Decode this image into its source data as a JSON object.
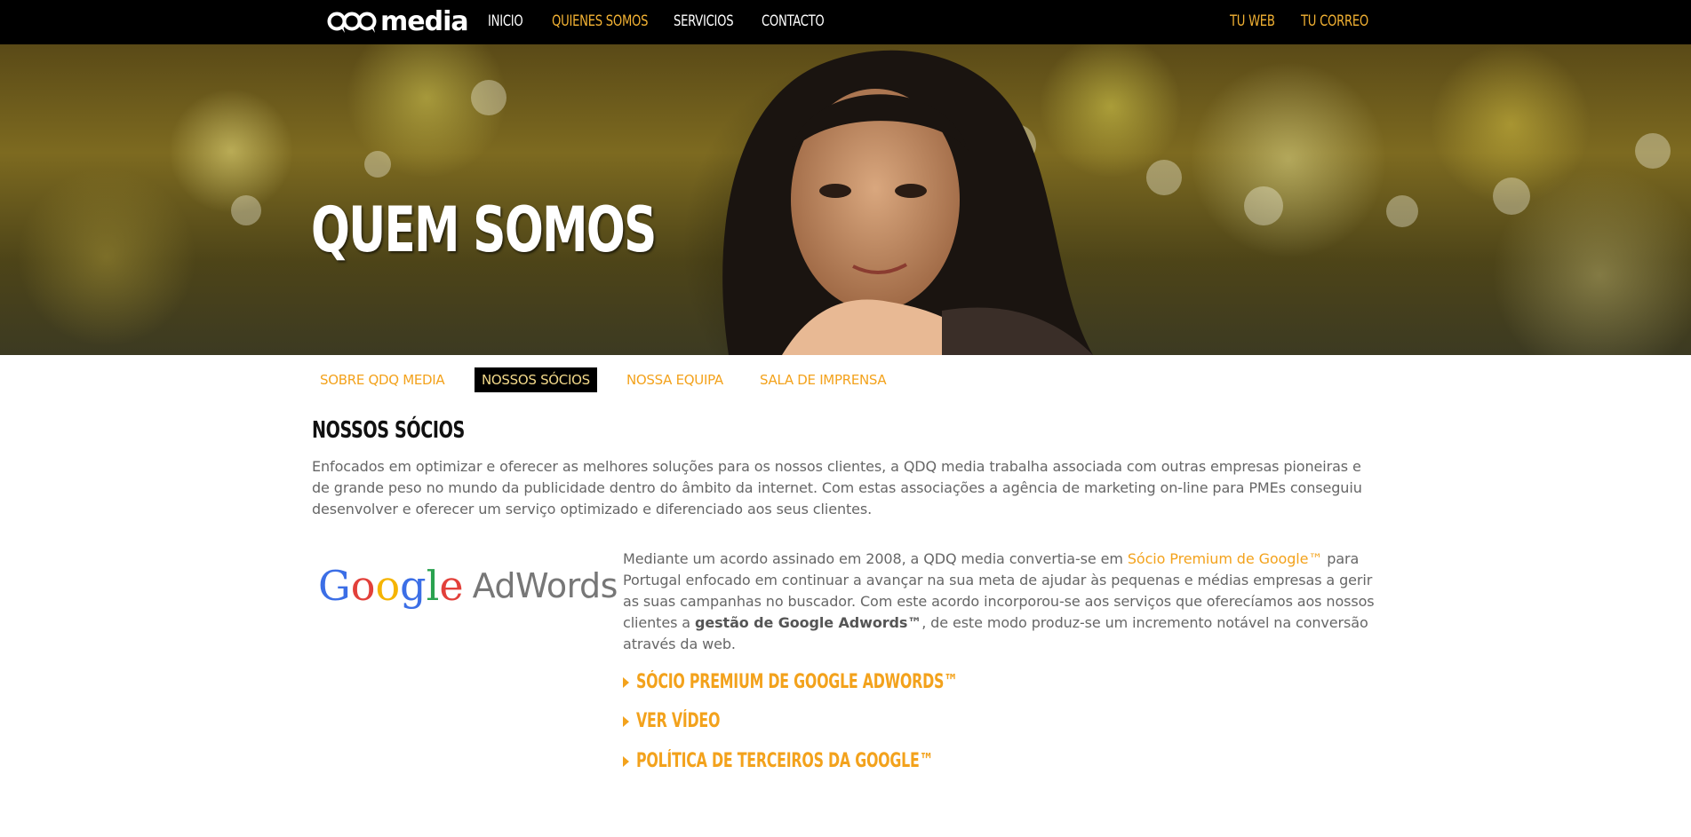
{
  "brand": {
    "logo_text": "media"
  },
  "nav": {
    "items": [
      {
        "label": "INICIO"
      },
      {
        "label": "QUIENES SOMOS"
      },
      {
        "label": "SERVICIOS"
      },
      {
        "label": "CONTACTO"
      }
    ],
    "right": [
      {
        "label": "TU WEB"
      },
      {
        "label": "TU CORREO"
      }
    ]
  },
  "hero": {
    "title": "QUEM SOMOS"
  },
  "subnav": {
    "tabs": [
      {
        "label": "SOBRE QDQ MEDIA"
      },
      {
        "label": "NOSSOS SÓCIOS"
      },
      {
        "label": "NOSSA EQUIPA"
      },
      {
        "label": "SALA DE IMPRENSA"
      }
    ]
  },
  "section": {
    "title": "NOSSOS SÓCIOS",
    "intro": "Enfocados em optimizar e oferecer as melhores soluções para os nossos clientes, a QDQ media trabalha associada com outras empresas pioneiras e de grande peso no mundo da publicidade dentro do âmbito da internet. Com estas associações a agência de marketing on-line para PMEs conseguiu desenvolver e oferecer um serviço optimizado e diferenciado aos seus clientes."
  },
  "partner": {
    "logo_google": "Google",
    "logo_adwords": "AdWords",
    "text_part1": "Mediante um acordo assinado em 2008, a QDQ media convertia-se em ",
    "text_highlight": "Sócio Premium de Google™",
    "text_part2": " para Portugal enfocado em continuar a avançar na sua meta de ajudar às pequenas e médias empresas a gerir as suas campanhas no buscador. Com este acordo incorporou-se aos serviços que oferecíamos aos nossos clientes a ",
    "text_bold": "gestão de Google Adwords™",
    "text_part3": ", de este modo produz-se um incremento notável na conversão através da web.",
    "links": [
      {
        "label": "SÓCIO PREMIUM DE GOOGLE ADWORDS™"
      },
      {
        "label": "VER VÍDEO"
      },
      {
        "label": "POLÍTICA DE TERCEIROS DA GOOGLE™"
      }
    ]
  },
  "colors": {
    "accent": "#f3a21c",
    "nav_active": "#f3b233",
    "nav_bg": "#000000",
    "body_text": "#666666"
  },
  "icons": [
    "qdq-logo-icon",
    "triangle-right-icon"
  ]
}
